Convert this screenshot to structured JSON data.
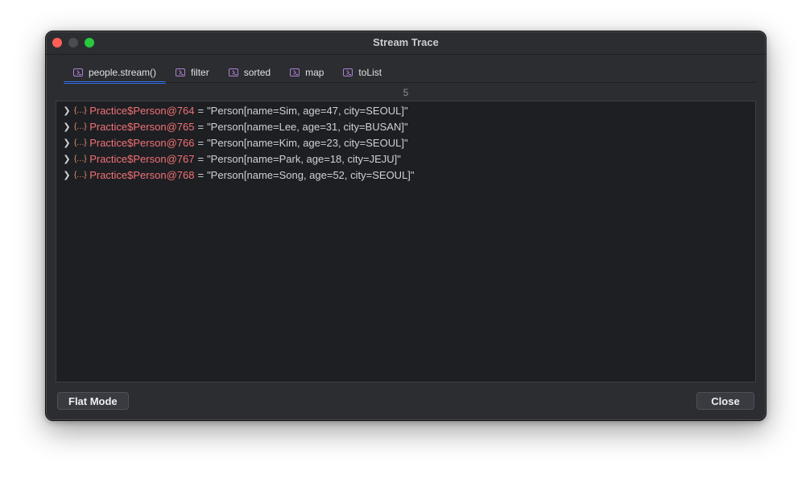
{
  "window": {
    "title": "Stream Trace"
  },
  "tabs": [
    {
      "label": "people.stream()",
      "active": true
    },
    {
      "label": "filter",
      "active": false
    },
    {
      "label": "sorted",
      "active": false
    },
    {
      "label": "map",
      "active": false
    },
    {
      "label": "toList",
      "active": false
    }
  ],
  "count": "5",
  "rows": [
    {
      "name": "Practice$Person@764",
      "value": "\"Person[name=Sim, age=47, city=SEOUL]\""
    },
    {
      "name": "Practice$Person@765",
      "value": "\"Person[name=Lee, age=31, city=BUSAN]\""
    },
    {
      "name": "Practice$Person@766",
      "value": "\"Person[name=Kim, age=23, city=SEOUL]\""
    },
    {
      "name": "Practice$Person@767",
      "value": "\"Person[name=Park, age=18, city=JEJU]\""
    },
    {
      "name": "Practice$Person@768",
      "value": "\"Person[name=Song, age=52, city=SEOUL]\""
    }
  ],
  "buttons": {
    "flat_mode": "Flat Mode",
    "close": "Close"
  },
  "colors": {
    "accent": "#3574f0",
    "object_name": "#f07178",
    "tab_icon": "#b07fd6"
  }
}
